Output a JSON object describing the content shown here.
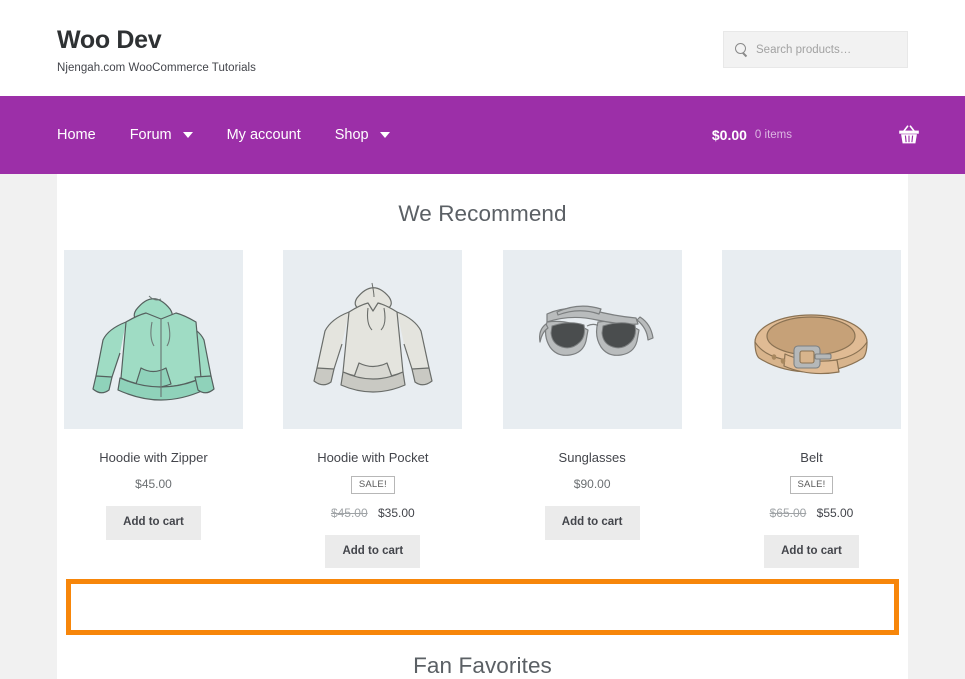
{
  "header": {
    "site_title": "Woo Dev",
    "tagline": "Njengah.com WooCommerce Tutorials",
    "search": {
      "placeholder": "Search products…",
      "value": "",
      "icon": "search-icon"
    }
  },
  "nav": {
    "background_color": "#9c2fa8",
    "items": [
      {
        "label": "Home",
        "has_dropdown": false
      },
      {
        "label": "Forum",
        "has_dropdown": true
      },
      {
        "label": "My account",
        "has_dropdown": false
      },
      {
        "label": "Shop",
        "has_dropdown": true
      }
    ],
    "cart": {
      "amount": "$0.00",
      "count": "0 items",
      "icon": "shopping-basket-icon"
    }
  },
  "main": {
    "recommend_heading": "We Recommend",
    "fan_favorites_heading": "Fan Favorites",
    "add_to_cart_label": "Add to cart",
    "sale_label": "SALE!",
    "products": [
      {
        "name": "Hoodie with Zipper",
        "image": "green-zip-hoodie",
        "on_sale": false,
        "price": "$45.00",
        "regular_price": "",
        "sale_price": ""
      },
      {
        "name": "Hoodie with Pocket",
        "image": "gray-pullover-hoodie",
        "on_sale": true,
        "price": "",
        "regular_price": "$45.00",
        "sale_price": "$35.00"
      },
      {
        "name": "Sunglasses",
        "image": "sunglasses",
        "on_sale": false,
        "price": "$90.00",
        "regular_price": "",
        "sale_price": ""
      },
      {
        "name": "Belt",
        "image": "leather-belt",
        "on_sale": true,
        "price": "",
        "regular_price": "$65.00",
        "sale_price": "$55.00"
      }
    ],
    "annotation": {
      "color": "#f7860a",
      "note": ""
    }
  }
}
